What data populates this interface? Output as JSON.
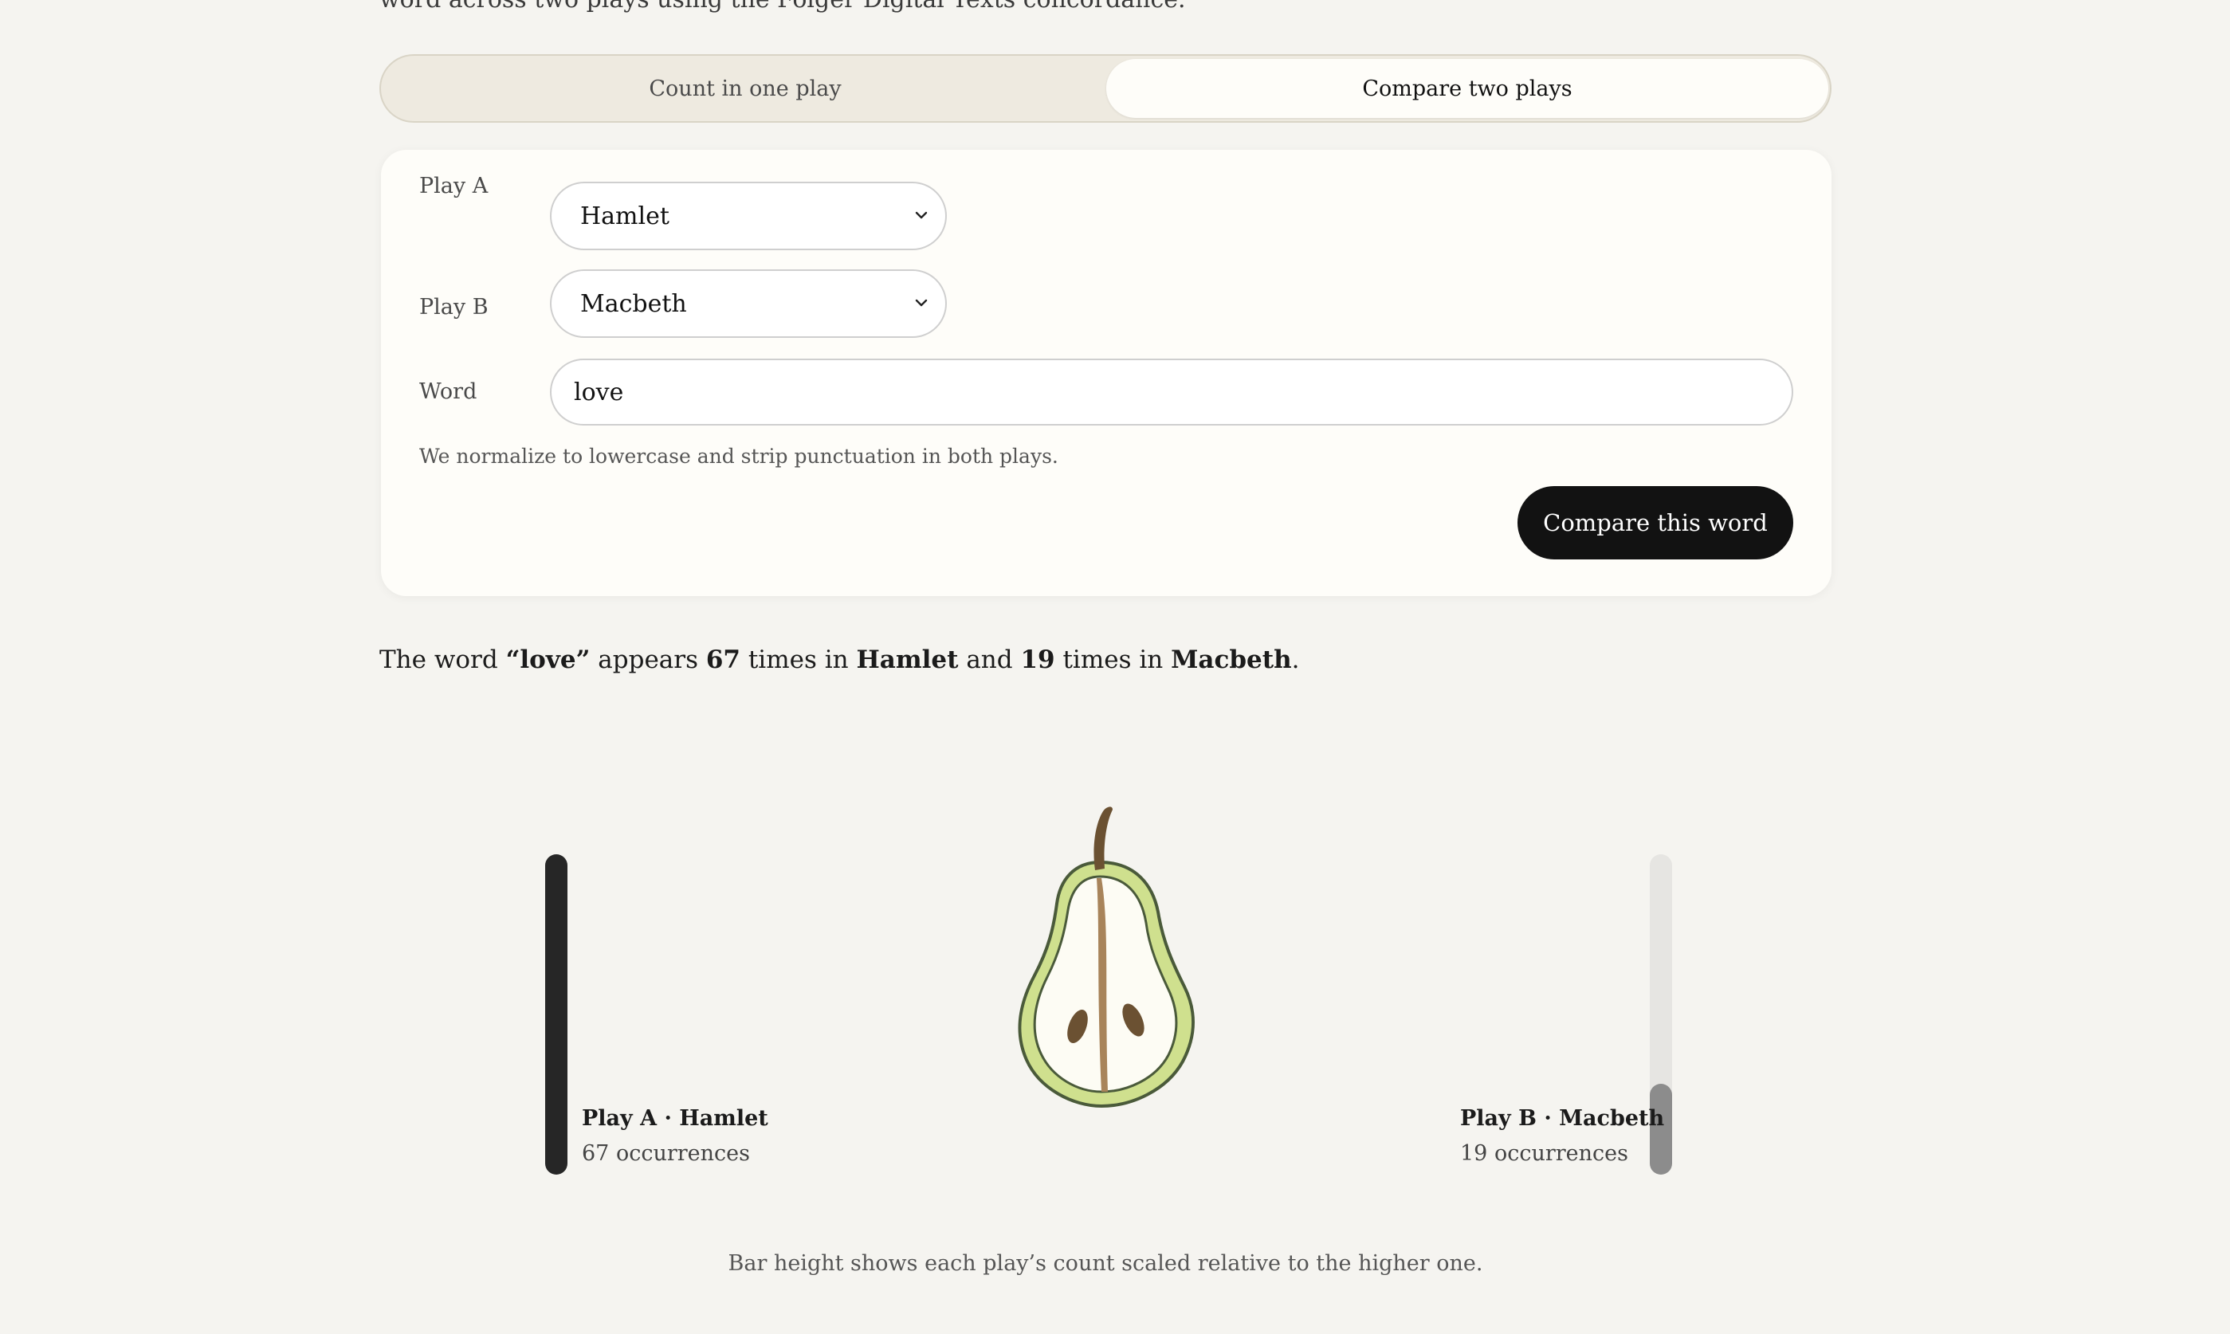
{
  "intro": {
    "text": "word across two plays using the Folger Digital Texts concordance."
  },
  "tabs": [
    {
      "label": "Count in one play",
      "active": false
    },
    {
      "label": "Compare two plays",
      "active": true
    }
  ],
  "form": {
    "play_a_label": "Play A",
    "play_a_value": "Hamlet",
    "play_b_label": "Play B",
    "play_b_value": "Macbeth",
    "word_label": "Word",
    "word_value": "love",
    "hint": "We normalize to lowercase and strip punctuation in both plays.",
    "submit_label": "Compare this word"
  },
  "result": {
    "prefix": "The word ",
    "word": "“love”",
    "mid1": " appears ",
    "count_a": "67",
    "mid2": " times in ",
    "play_a": "Hamlet",
    "mid3": " and ",
    "count_b": "19",
    "mid4": " times in ",
    "play_b": "Macbeth",
    "suffix": "."
  },
  "bars": {
    "a": {
      "title": "Play A · Hamlet",
      "sub": "67 occurrences",
      "count": 67,
      "fill_fraction": 1.0
    },
    "b": {
      "title": "Play B · Macbeth",
      "sub": "19 occurrences",
      "count": 19,
      "fill_fraction": 0.2836
    }
  },
  "caption": "Bar height shows each play’s count scaled relative to the higher one.",
  "colors": {
    "background": "#f5f4f0",
    "bar_a": "#262626",
    "bar_b": "#8c8c8c",
    "button": "#121212",
    "pear_skin": "#cfe08e"
  },
  "icons": {
    "select_chevron": "chevron-down-icon",
    "illustration": "pear-half-icon"
  }
}
